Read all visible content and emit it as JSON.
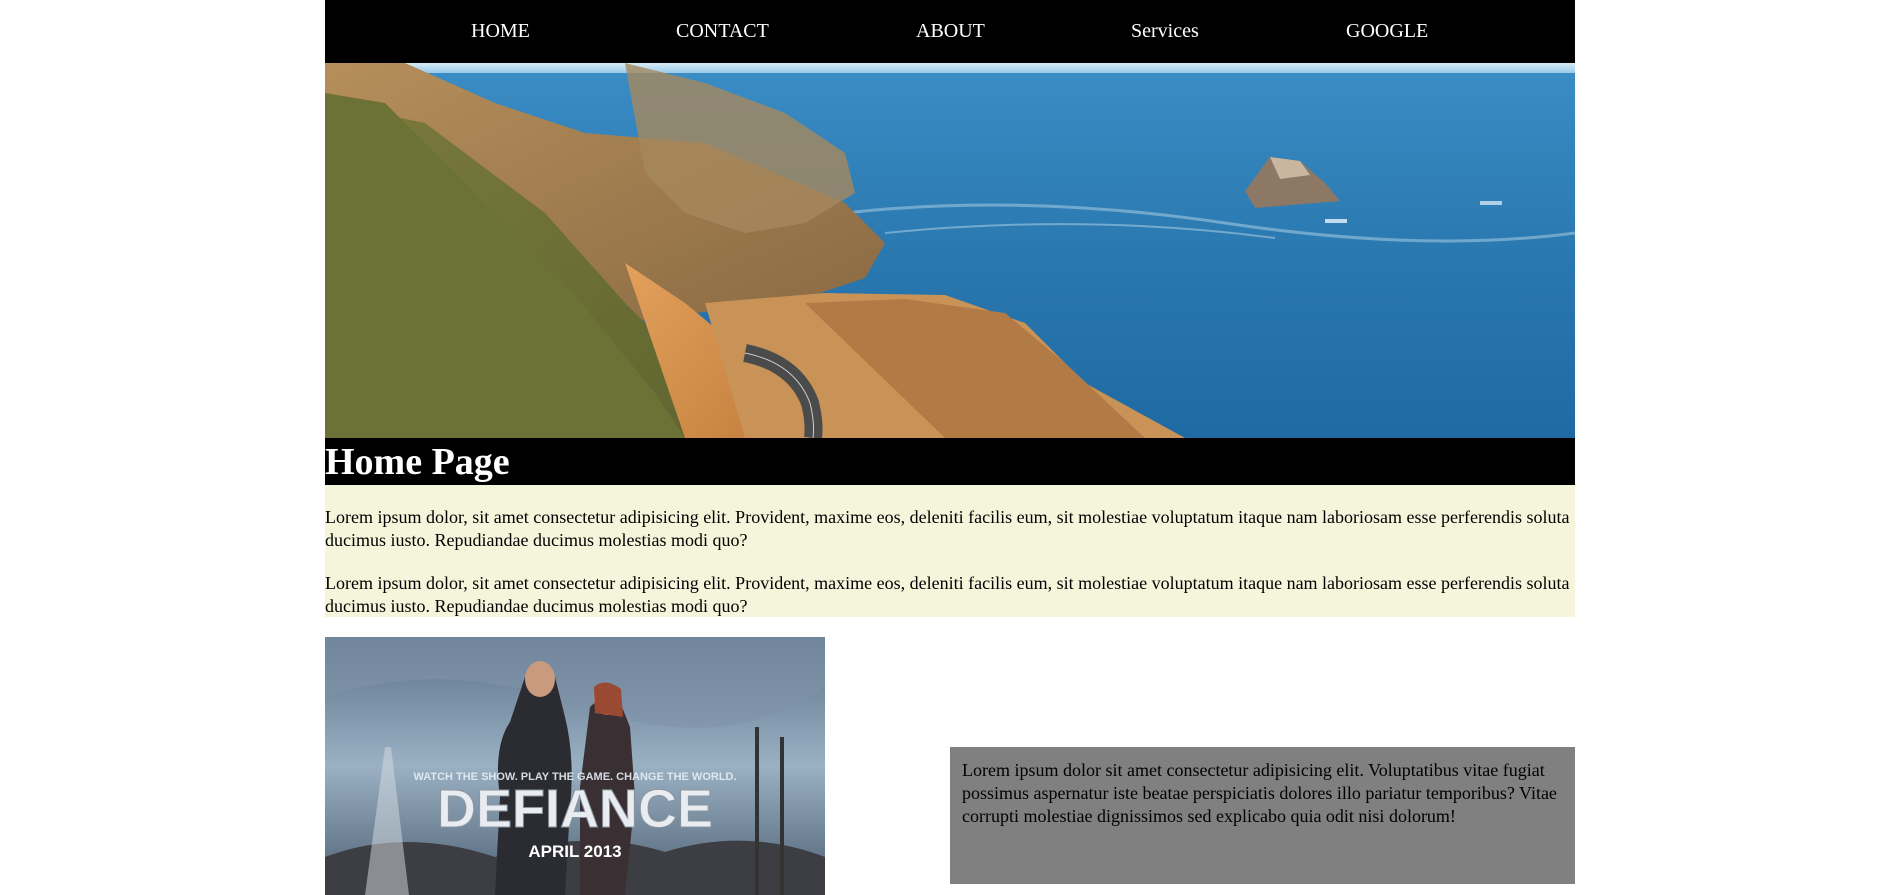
{
  "nav": {
    "items": [
      {
        "label": "HOME"
      },
      {
        "label": "CONTACT"
      },
      {
        "label": "ABOUT"
      },
      {
        "label": "Services"
      },
      {
        "label": "GOOGLE"
      }
    ]
  },
  "hero": {
    "description": "Coastal cliffs with winding road beside blue ocean"
  },
  "main": {
    "title": "Home Page",
    "paragraphs": [
      "Lorem ipsum dolor, sit amet consectetur adipisicing elit. Provident, maxime eos, deleniti facilis eum, sit molestiae voluptatum itaque nam laboriosam esse perferendis soluta ducimus iusto. Repudiandae ducimus molestias modi quo?",
      "Lorem ipsum dolor, sit amet consectetur adipisicing elit. Provident, maxime eos, deleniti facilis eum, sit molestiae voluptatum itaque nam laboriosam esse perferendis soluta ducimus iusto. Repudiandae ducimus molestias modi quo?"
    ]
  },
  "poster": {
    "tagline": "WATCH THE SHOW. PLAY THE GAME. CHANGE THE WORLD.",
    "title": "DEFIANCE",
    "date": "APRIL 2013"
  },
  "sidebox": {
    "text": "Lorem ipsum dolor sit amet consectetur adipisicing elit. Voluptatibus vitae fugiat possimus aspernatur iste beatae perspiciatis dolores illo pariatur temporibus? Vitae corrupti molestiae dignissimos sed explicabo quia odit nisi dolorum!"
  },
  "colors": {
    "nav_bg": "#000000",
    "intro_bg": "#f5f5dc",
    "sidebox_bg": "#808080"
  }
}
